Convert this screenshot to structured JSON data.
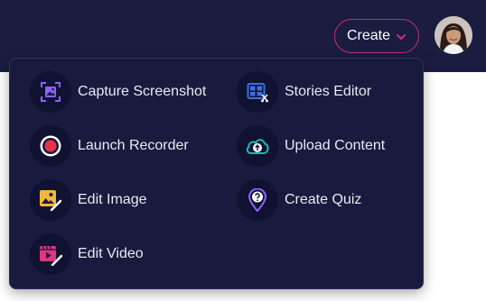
{
  "header": {
    "create_label": "Create",
    "avatar_alt": "User avatar"
  },
  "menu": {
    "items": [
      {
        "label": "Capture Screenshot",
        "icon": "capture-screenshot-icon"
      },
      {
        "label": "Stories Editor",
        "icon": "stories-editor-icon"
      },
      {
        "label": "Launch Recorder",
        "icon": "record-icon"
      },
      {
        "label": "Upload Content",
        "icon": "cloud-upload-icon"
      },
      {
        "label": "Edit Image",
        "icon": "edit-image-icon"
      },
      {
        "label": "Create Quiz",
        "icon": "quiz-icon"
      },
      {
        "label": "Edit Video",
        "icon": "edit-video-icon"
      }
    ]
  },
  "colors": {
    "topbar": "#1a1d3f",
    "menu_bg": "#181b3d",
    "accent": "#d4296f",
    "icon_purple": "#8e62ff",
    "icon_blue": "#3d6fe6",
    "icon_red": "#e8334a",
    "icon_teal": "#1fb6b6",
    "icon_yellow": "#f5b73a",
    "icon_pink": "#e0357f"
  }
}
